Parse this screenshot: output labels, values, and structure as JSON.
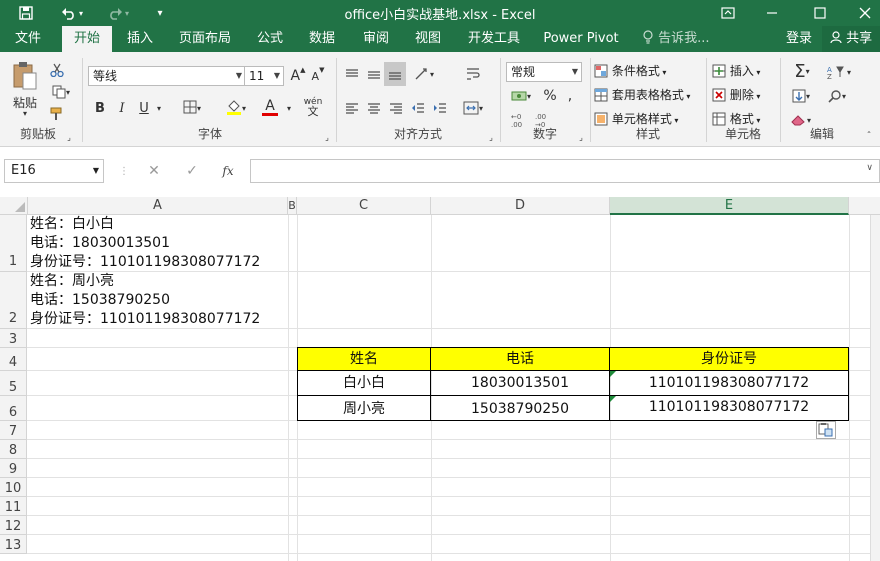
{
  "window": {
    "title": "office小白实战基地.xlsx - Excel",
    "icons": [
      "save-icon",
      "undo-icon",
      "redo-icon",
      "customize-icon",
      "ribbon-display-icon",
      "minimize-icon",
      "maximize-icon",
      "close-icon"
    ]
  },
  "tabs": {
    "items": [
      "文件",
      "开始",
      "插入",
      "页面布局",
      "公式",
      "数据",
      "审阅",
      "视图",
      "开发工具",
      "Power Pivot"
    ],
    "active": "开始",
    "tell_me": "告诉我...",
    "signin": "登录",
    "share": "共享"
  },
  "ribbon": {
    "clipboard": {
      "label": "剪贴板",
      "paste": "粘贴"
    },
    "font": {
      "label": "字体",
      "name": "等线",
      "size": "11",
      "bold": "B",
      "italic": "I",
      "underline": "U",
      "grow": "A",
      "shrink": "A",
      "color_letter": "A",
      "phonetic": "wén"
    },
    "alignment": {
      "label": "对齐方式"
    },
    "number": {
      "label": "数字",
      "format": "常规",
      "percent": "%",
      "comma": ","
    },
    "styles": {
      "label": "样式",
      "conditional": "条件格式",
      "table": "套用表格格式",
      "cell_styles": "单元格样式"
    },
    "cells": {
      "label": "单元格",
      "insert": "插入",
      "delete": "删除",
      "format": "格式"
    },
    "editing": {
      "label": "编辑"
    }
  },
  "formula_bar": {
    "name_box": "E16",
    "cancel": "✕",
    "enter": "✓",
    "fx": "fx",
    "value": ""
  },
  "columns": [
    "A",
    "B",
    "C",
    "D",
    "E"
  ],
  "selected_column": "E",
  "rows": [
    "1",
    "2",
    "3",
    "4",
    "5",
    "6",
    "7",
    "8",
    "9",
    "10",
    "11",
    "12",
    "13"
  ],
  "cells": {
    "A1": [
      "姓名：白小白",
      "电话：18030013501",
      "身份证号：110101198308077172"
    ],
    "A2": [
      "姓名：周小亮",
      "电话：15038790250",
      "身份证号：110101198308077172"
    ]
  },
  "table": {
    "headers": [
      "姓名",
      "电话",
      "身份证号"
    ],
    "rows": [
      [
        "白小白",
        "18030013501",
        "110101198308077172"
      ],
      [
        "周小亮",
        "15038790250",
        "110101198308077172"
      ]
    ],
    "header_fill": "#ffff00"
  },
  "colors": {
    "accent": "#217346"
  }
}
